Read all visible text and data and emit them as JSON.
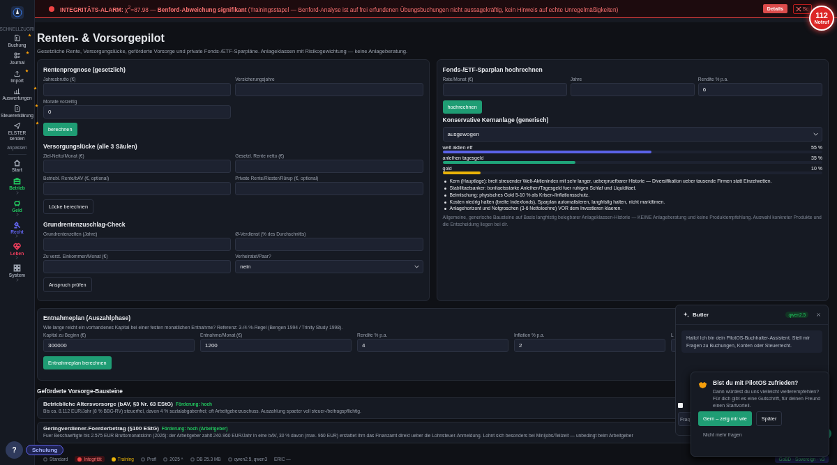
{
  "alarm": {
    "text": "**INTEGRITÄTS-ALARM:** χ$^{2}$=87.98 — **Benford-Abweichung signifikant** (Trainingsstapel — Benford-Analyse ist auf frei erfundenen Übungsbuchungen nicht aussagekräftig, kein Hinweis auf echte Unregelmäßigkeiten)",
    "details_button": "Details",
    "close_button": "Sc"
  },
  "emergency": {
    "number": "112",
    "label": "Notruf"
  },
  "sidebar": {
    "section": "SCHNELLZUGRI",
    "quick_items": [
      {
        "label": "Buchung",
        "starred": true
      },
      {
        "label": "Journal",
        "starred": true
      },
      {
        "label": "Import",
        "starred": true
      },
      {
        "label": "Auswertungen",
        "starred": true
      },
      {
        "label": "Steuererklärung",
        "starred": true
      },
      {
        "label": "ELSTER senden",
        "starred": true
      }
    ],
    "customize": "anpassen",
    "groups": [
      {
        "label": "Start",
        "color": "#9aa1ad",
        "expandable": false
      },
      {
        "label": "Betrieb",
        "color": "#22c55e",
        "expandable": true
      },
      {
        "label": "Geld",
        "color": "#22c55e",
        "expandable": true
      },
      {
        "label": "Recht",
        "color": "#6366f1",
        "expandable": true
      },
      {
        "label": "Leben",
        "color": "#f43f5e",
        "expandable": true
      },
      {
        "label": "System",
        "color": "#9aa1ad",
        "expandable": true
      }
    ]
  },
  "page": {
    "title": "Renten- & Vorsorgepilot",
    "subtitle": "Gesetzliche Rente, Versorgungslücke, geförderte Vorsorge und private Fonds-/ETF-Sparpläne. Anlageklassen mit Risikogewichtung — keine Anlageberatung."
  },
  "left_card": {
    "sections": [
      {
        "title": "Rentenprognose (gesetzlich)",
        "fields": [
          {
            "kind": "input",
            "label": "Jahresbrutto (€)"
          },
          {
            "kind": "input",
            "label": "Versicherungsjahre"
          },
          {
            "kind": "input",
            "label": "Monate vorzeitig",
            "value": "0"
          }
        ],
        "button": {
          "label": "berechnen",
          "primary": true
        }
      },
      {
        "title": "Versorgungslücke (alle 3 Säulen)",
        "fields": [
          {
            "kind": "input",
            "label": "Ziel-Netto/Monat (€)"
          },
          {
            "kind": "input",
            "label": "Gesetzl. Rente netto (€)"
          },
          {
            "kind": "input",
            "label": "Betriebl. Rente/bAV (€, optional)"
          },
          {
            "kind": "input",
            "label": "Private Rente/Riester/Rürup (€, optional)"
          }
        ],
        "button": {
          "label": "Lücke berechnen",
          "primary": false
        }
      },
      {
        "title": "Grundrentenzuschlag-Check",
        "fields": [
          {
            "kind": "input",
            "label": "Grundrentenzeiten (Jahre)"
          },
          {
            "kind": "input",
            "label": "Ø-Verdienst (% des Durchschnitts)"
          },
          {
            "kind": "input",
            "label": "Zu verst. Einkommen/Monat (€)"
          },
          {
            "kind": "select",
            "label": "Verheiratet/Paar?",
            "value": "nein"
          }
        ],
        "button": {
          "label": "Anspruch prüfen",
          "primary": false
        }
      }
    ]
  },
  "right_card": {
    "title": "Fonds-/ETF-Sparplan hochrechnen",
    "fields": [
      {
        "label": "Rate/Monat (€)"
      },
      {
        "label": "Jahre"
      },
      {
        "label": "Rendite % p.a.",
        "value": "6"
      }
    ],
    "button": "hochrechnen",
    "core": {
      "title": "Konservative Kernanlage (generisch)",
      "profile": "ausgewogen",
      "allocations": [
        {
          "name": "welt aktien etf",
          "reading": "55 %",
          "level": 0.55,
          "color": "#5b63e8"
        },
        {
          "name": "anleihen tagesgeld",
          "reading": "35 %",
          "level": 0.35,
          "color": "#1fa57a"
        },
        {
          "name": "gold",
          "reading": "10 %",
          "level": 0.1,
          "color": "#eab308"
        }
      ],
      "bullets": [
        "Kern (Hauptlage): breit streuender Welt-Aktienindex mit sehr langer, ueberpruefbarer Historie — Diversifikation ueber tausende Firmen statt Einzelwetten.",
        "Stabilitaetsanker: bonitaetsstarke Anleihen/Tagesgeld fuer ruhigen Schlaf und Liquiditaet.",
        "Beimischung: physisches Gold 5-10 % als Krisen-/Inflationsschutz.",
        "Kosten niedrig halten (breite Indexfonds), Sparplan automatisieren, langfristig halten, nicht markttimen.",
        "Anlagehorizont und Notgroschen (3-6 Nettoloehne) VOR dem Investieren klaeren."
      ],
      "disclaimer": "Allgemeine, generische Bausteine auf Basis langfristig belegbarer Anlageklassen-Historie — KEINE Anlageberatung und keine Produktempfehlung. Auswahl konkreter Produkte und die Entscheidung liegen bei dir."
    }
  },
  "withdrawal": {
    "title": "Entnahmeplan (Auszahlphase)",
    "hint": "Wie lange reicht ein vorhandenes Kapital bei einer festen monatlichen Entnahme? Referenz: 3-/4-%-Regel (Bengen 1994 / Trinity Study 1998).",
    "fields": [
      {
        "label": "Kapital zu Beginn (€)",
        "value": "300000"
      },
      {
        "label": "Entnahme/Monat (€)",
        "value": "1200"
      },
      {
        "label": "Rendite % p.a.",
        "value": "4"
      },
      {
        "label": "Inflation % p.a.",
        "value": "2"
      },
      {
        "label": "L"
      }
    ],
    "button": "Entnahmeplan berechnen"
  },
  "subsidized": {
    "title": "Geförderte Vorsorge-Bausteine",
    "items": [
      {
        "title": "Betriebliche Altersvorsorge (bAV, §3 Nr. 63 EStG)",
        "badge": "Förderung: hoch",
        "text": "Bis ca. 8.112 EUR/Jahr (8 % BBG-RV) steuerfrei, davon 4 % sozialabgabenfrei; oft Arbeitgeberzuschuss. Auszahlung spaeter voll steuer-/beitragspflichtig."
      },
      {
        "title": "Geringverdiener-Foerderbetrag (§100 EStG)",
        "badge": "Förderung: hoch (Arbeitgeber)",
        "text": "Fuer Beschaeftigte bis 2.575 EUR Bruttomonatslohn (2026): der Arbeitgeber zahlt 240-960 EUR/Jahr in eine bAV, 30 % davon (max. 960 EUR) erstattet ihm das Finanzamt direkt ueber die Lohnsteuer-Anmeldung. Lohnt sich besonders bei Minijobs/Teilzeit — unbedingt beim Arbeitgeber"
      }
    ]
  },
  "butler": {
    "title": "Butler",
    "model": "qwen2.5",
    "message": "Hallo! Ich bin dein PilotOS-Buchhalter-Assistent. Stell mir Fragen zu Buchungen, Konten oder Steuerrecht.",
    "checked": false,
    "input_placeholder": "Frag"
  },
  "feedback": {
    "title": "Bist du mit PilotOS zufrieden?",
    "text": "Dann würdest du uns vielleicht weiterempfehlen? Für dich gibt es eine Gutschrift, für deinen Freund einen Startvorteil.",
    "accept": "Gern – zeig mir wie",
    "later": "Später",
    "never": "Nicht mehr fragen"
  },
  "help_button": "?",
  "training_pill": "Schulung",
  "status_bar": {
    "items": [
      {
        "kind": "icon",
        "label": "Standard"
      },
      {
        "kind": "alert",
        "label": "Integrität",
        "color": "#ef4444"
      },
      {
        "kind": "dot",
        "label": "Training",
        "color": "#eab308"
      },
      {
        "kind": "icon",
        "label": "Profi"
      },
      {
        "kind": "icon",
        "label": "2025 ^"
      },
      {
        "kind": "icon",
        "label": "DB 25.3 MB"
      },
      {
        "kind": "icon",
        "label": "qwen2.5, qwen3"
      },
      {
        "kind": "text",
        "label": "ERIC —"
      }
    ],
    "version": "GoBD · Sovereign · v3"
  }
}
